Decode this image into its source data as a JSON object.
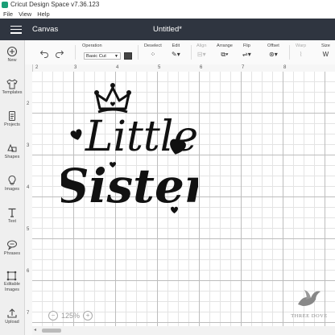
{
  "window": {
    "title": "Cricut Design Space  v7.36.123"
  },
  "menu": [
    "File",
    "View",
    "Help"
  ],
  "header": {
    "section": "Canvas",
    "document_title": "Untitled*"
  },
  "sidebar": {
    "items": [
      {
        "label": "New",
        "icon": "plus-circle-icon"
      },
      {
        "label": "Templates",
        "icon": "shirt-icon"
      },
      {
        "label": "Projects",
        "icon": "projects-icon"
      },
      {
        "label": "Shapes",
        "icon": "shapes-icon"
      },
      {
        "label": "Images",
        "icon": "lightbulb-icon"
      },
      {
        "label": "Text",
        "icon": "text-icon"
      },
      {
        "label": "Phrases",
        "icon": "speech-bubble-icon"
      },
      {
        "label": "Editable Images",
        "icon": "editable-images-icon"
      },
      {
        "label": "Upload",
        "icon": "upload-icon"
      }
    ]
  },
  "toolbar": {
    "operation_label": "Operation",
    "operation_value": "Basic Cut",
    "operation_color": "#444444",
    "deselect_label": "Deselect",
    "edit_label": "Edit",
    "align_label": "Align",
    "arrange_label": "Arrange",
    "flip_label": "Flip",
    "offset_label": "Offset",
    "warp_label": "Warp",
    "size_label": "Size"
  },
  "ruler": {
    "top": [
      "2",
      "3",
      "4",
      "5",
      "6",
      "7",
      "8"
    ],
    "left": [
      "2",
      "3",
      "4",
      "5",
      "6",
      "7"
    ]
  },
  "design": {
    "text_line1": "Little",
    "text_line2": "Sister"
  },
  "zoom": {
    "value": "125%"
  },
  "watermark": {
    "text": "THREE DOVE"
  }
}
